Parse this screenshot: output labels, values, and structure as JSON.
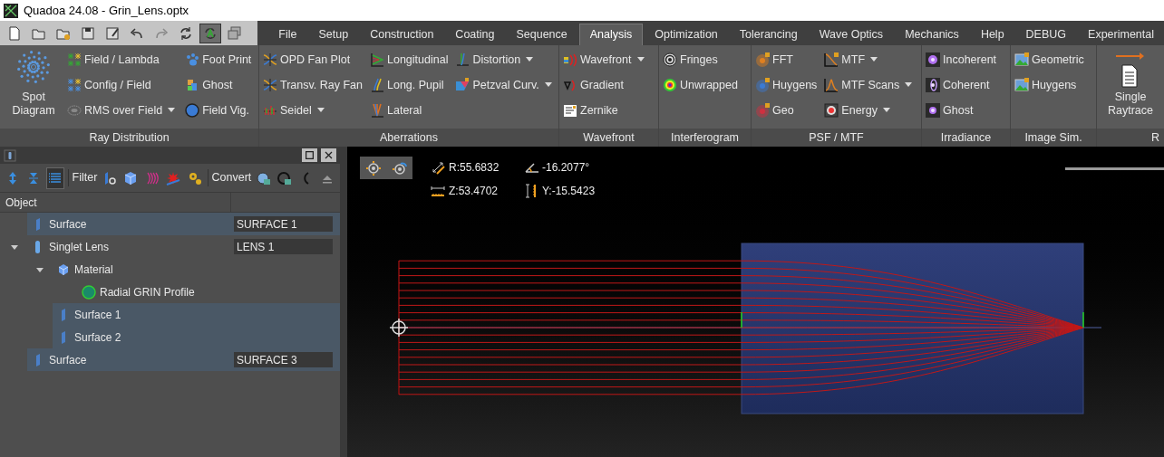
{
  "window": {
    "title": "Quadoa 24.08 - Grin_Lens.optx"
  },
  "quick_toolbar": [
    {
      "on": false
    },
    {
      "on": false
    },
    {
      "on": false
    },
    {
      "on": false
    },
    {
      "on": false
    },
    {
      "on": false
    },
    {
      "on": false
    },
    {
      "on": false
    },
    {
      "on": true
    },
    {
      "on": false
    }
  ],
  "tabs": [
    {
      "label": "File",
      "selected": false
    },
    {
      "label": "Setup",
      "selected": false
    },
    {
      "label": "Construction",
      "selected": false
    },
    {
      "label": "Coating",
      "selected": false
    },
    {
      "label": "Sequence",
      "selected": false
    },
    {
      "label": "Analysis",
      "selected": true
    },
    {
      "label": "Optimization",
      "selected": false
    },
    {
      "label": "Tolerancing",
      "selected": false
    },
    {
      "label": "Wave Optics",
      "selected": false
    },
    {
      "label": "Mechanics",
      "selected": false
    },
    {
      "label": "Help",
      "selected": false
    },
    {
      "label": "DEBUG",
      "selected": false
    },
    {
      "label": "Experimental",
      "selected": false
    }
  ],
  "ribbon": {
    "groups": [
      {
        "label": "Ray Distribution",
        "columns": [
          [
            {
              "label": "Spot Diagram",
              "kind": "large",
              "dropdown": false
            }
          ],
          [
            {
              "label": "Field / Lambda",
              "kind": "small",
              "dropdown": false
            },
            {
              "label": "Config / Field",
              "kind": "small",
              "dropdown": false
            },
            {
              "label": "RMS over Field",
              "kind": "small",
              "dropdown": true
            }
          ],
          [
            {
              "label": "Foot Print",
              "kind": "small",
              "dropdown": false
            },
            {
              "label": "Ghost",
              "kind": "small",
              "dropdown": false
            },
            {
              "label": "Field Vig.",
              "kind": "small",
              "dropdown": false
            }
          ]
        ]
      },
      {
        "label": "Aberrations",
        "columns": [
          [
            {
              "label": "OPD Fan Plot",
              "kind": "small",
              "dropdown": false
            },
            {
              "label": "Transv. Ray Fan",
              "kind": "small",
              "dropdown": false
            },
            {
              "label": "Seidel",
              "kind": "small",
              "dropdown": true
            }
          ],
          [
            {
              "label": "Longitudinal",
              "kind": "small",
              "dropdown": false
            },
            {
              "label": "Long. Pupil",
              "kind": "small",
              "dropdown": false
            },
            {
              "label": "Lateral",
              "kind": "small",
              "dropdown": false
            }
          ],
          [
            {
              "label": "Distortion",
              "kind": "small",
              "dropdown": true
            },
            {
              "label": "Petzval Curv.",
              "kind": "small",
              "dropdown": true
            }
          ]
        ]
      },
      {
        "label": "Wavefront",
        "columns": [
          [
            {
              "label": "Wavefront",
              "kind": "small",
              "dropdown": true
            },
            {
              "label": "Gradient",
              "kind": "small",
              "dropdown": false
            },
            {
              "label": "Zernike",
              "kind": "small",
              "dropdown": false
            }
          ]
        ]
      },
      {
        "label": "Interferogram",
        "columns": [
          [
            {
              "label": "Fringes",
              "kind": "small",
              "dropdown": false
            },
            {
              "label": "Unwrapped",
              "kind": "small",
              "dropdown": false
            }
          ]
        ]
      },
      {
        "label": "PSF / MTF",
        "columns": [
          [
            {
              "label": "FFT",
              "kind": "small",
              "dropdown": false
            },
            {
              "label": "Huygens",
              "kind": "small",
              "dropdown": false
            },
            {
              "label": "Geo",
              "kind": "small",
              "dropdown": false
            }
          ],
          [
            {
              "label": "MTF",
              "kind": "small",
              "dropdown": true
            },
            {
              "label": "MTF Scans",
              "kind": "small",
              "dropdown": true
            },
            {
              "label": "Energy",
              "kind": "small",
              "dropdown": true
            }
          ]
        ]
      },
      {
        "label": "Irradiance",
        "columns": [
          [
            {
              "label": "Incoherent",
              "kind": "small",
              "dropdown": false
            },
            {
              "label": "Coherent",
              "kind": "small",
              "dropdown": false
            },
            {
              "label": "Ghost",
              "kind": "small",
              "dropdown": false
            }
          ]
        ]
      },
      {
        "label": "Image Sim.",
        "columns": [
          [
            {
              "label": "Geometric",
              "kind": "small",
              "dropdown": false
            },
            {
              "label": "Huygens",
              "kind": "small",
              "dropdown": false
            }
          ]
        ]
      },
      {
        "label": "R",
        "columns": [
          [
            {
              "label": "Single Raytrace",
              "kind": "large",
              "dropdown": false
            }
          ]
        ]
      }
    ]
  },
  "panel": {
    "toolbar": [
      {
        "kind": "tool",
        "on": false
      },
      {
        "kind": "tool",
        "on": false
      },
      {
        "kind": "tool",
        "on": true
      },
      {
        "kind": "label",
        "text": "Filter"
      },
      {
        "kind": "tool",
        "on": false
      },
      {
        "kind": "tool",
        "on": false
      },
      {
        "kind": "tool",
        "on": false
      },
      {
        "kind": "tool",
        "on": false
      },
      {
        "kind": "tool",
        "on": false
      },
      {
        "kind": "label",
        "text": "Convert"
      },
      {
        "kind": "tool",
        "on": false
      },
      {
        "kind": "tool",
        "on": false
      },
      {
        "kind": "tool",
        "on": false
      },
      {
        "kind": "tool",
        "on": false
      }
    ],
    "column_header": "Object",
    "tree": [
      {
        "label": "Surface",
        "kind": "surface",
        "value": "SURFACE 1",
        "selected": true
      },
      {
        "label": "Singlet Lens",
        "kind": "lens",
        "value": "LENS 1",
        "selected": false,
        "expanded": true,
        "children": [
          {
            "label": "Material",
            "kind": "material",
            "selected": false,
            "expanded": true,
            "children": [
              {
                "label": "Radial GRIN Profile",
                "kind": "profile",
                "selected": false
              }
            ]
          },
          {
            "label": "Surface 1",
            "kind": "surface",
            "selected": true
          },
          {
            "label": "Surface 2",
            "kind": "surface",
            "selected": true
          }
        ]
      },
      {
        "label": "Surface",
        "kind": "surface",
        "value": "SURFACE 3",
        "selected": true
      }
    ]
  },
  "viewport": {
    "readouts": [
      {
        "kind": "radius",
        "text": "R:55.6832"
      },
      {
        "kind": "angle",
        "text": "-16.2077°"
      },
      {
        "kind": "z",
        "text": "Z:53.4702"
      },
      {
        "kind": "y",
        "text": "Y:-15.5423"
      }
    ]
  }
}
